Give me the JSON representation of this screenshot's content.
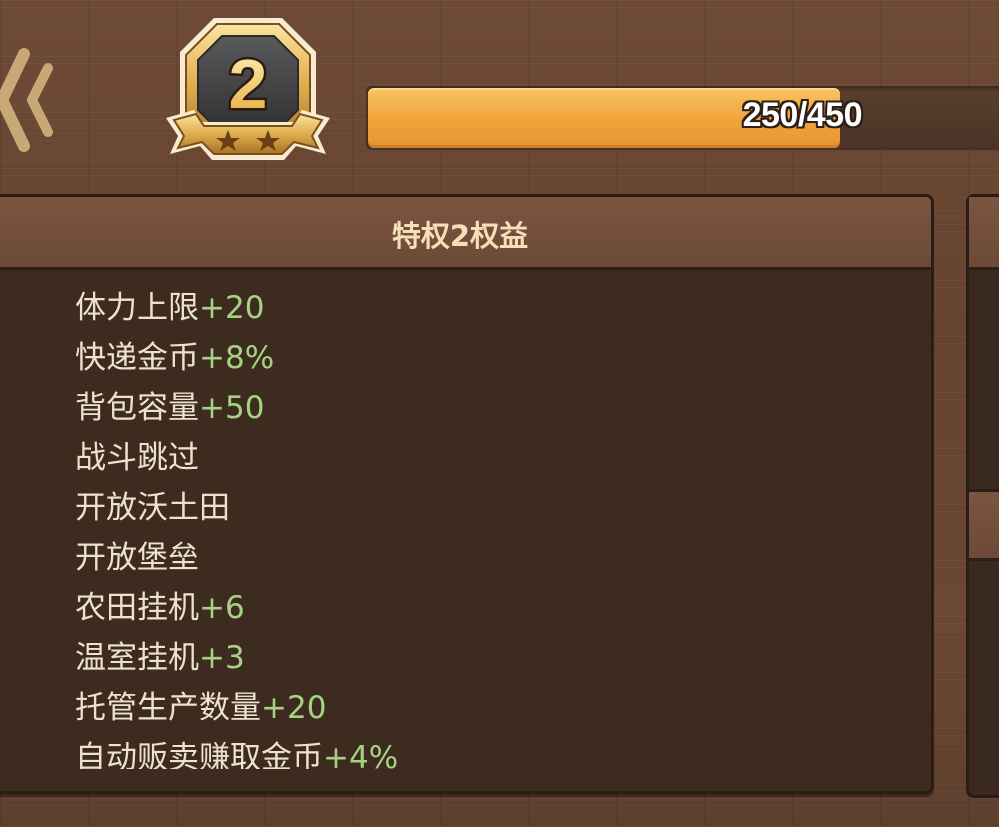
{
  "header": {
    "back_icon": "double-chevron-left-icon",
    "level_badge": {
      "level": "2",
      "stars": 2,
      "icon": "vip-level-badge-icon"
    },
    "progress": {
      "text": "250/450",
      "current": 250,
      "max": 450,
      "fraction": 0.5556
    }
  },
  "privilege_panel": {
    "title": "特权2权益",
    "items": [
      {
        "label": "体力上限",
        "value": "+20"
      },
      {
        "label": "快递金币",
        "value": "+8%"
      },
      {
        "label": "背包容量",
        "value": "+50"
      },
      {
        "label": "战斗跳过",
        "value": ""
      },
      {
        "label": "开放沃土田",
        "value": ""
      },
      {
        "label": "开放堡垒",
        "value": ""
      },
      {
        "label": "农田挂机",
        "value": "+6"
      },
      {
        "label": "温室挂机",
        "value": "+3"
      },
      {
        "label": "托管生产数量",
        "value": "+20"
      },
      {
        "label": "自动贩卖赚取金币",
        "value": "+4%"
      }
    ]
  },
  "colors": {
    "background_wood": "#6a4733",
    "panel_bg": "#3d2b20",
    "panel_header": "#774f3b",
    "title_text": "#f6dfb8",
    "item_text": "#eee2cf",
    "value_green": "#a7d283",
    "progress_fill": "#f0a23a",
    "badge_gold": "#d8a642"
  }
}
